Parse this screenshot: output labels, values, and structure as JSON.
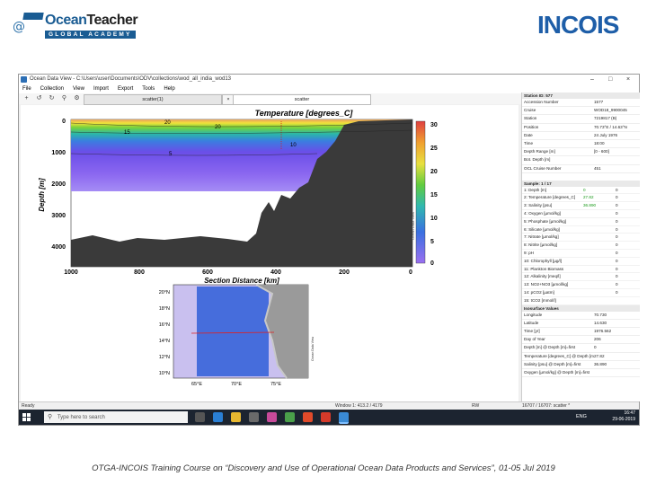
{
  "header": {
    "left_logo_brand": "OceanTeacher",
    "left_logo_ocean": "Ocean",
    "left_logo_teacher": "Teacher",
    "left_logo_sub": "GLOBAL ACADEMY",
    "right_logo": "INCOIS"
  },
  "window": {
    "title": "Ocean Data View - C:\\Users\\user\\Documents\\ODV\\collections\\wod_all_india_wod13",
    "controls": [
      "–",
      "□",
      "×"
    ]
  },
  "menu": [
    "File",
    "Collection",
    "View",
    "Import",
    "Export",
    "Tools",
    "Help"
  ],
  "tabs": [
    "scatter(1)",
    "scatter"
  ],
  "section_plot": {
    "title": "Temperature [degrees_C]",
    "ylabel": "Depth [m]",
    "xlabel": "Section Distance [km]",
    "y_ticks": [
      "0",
      "1000",
      "2000",
      "3000",
      "4000"
    ],
    "x_ticks": [
      "1000",
      "800",
      "600",
      "400",
      "200",
      "0"
    ],
    "contour_labels": [
      "20",
      "15",
      "20",
      "10",
      "5"
    ],
    "colorbar_ticks": [
      "30",
      "25",
      "20",
      "15",
      "10",
      "5",
      "0"
    ],
    "colorbar_caption": "Ocean Data View"
  },
  "map": {
    "lat_ticks": [
      "20°N",
      "18°N",
      "16°N",
      "14°N",
      "12°N",
      "10°N"
    ],
    "lon_ticks": [
      "65°E",
      "70°E",
      "75°E"
    ],
    "caption": "Ocean Data View"
  },
  "station_panel": {
    "header": "Station ID: 577",
    "rows": [
      {
        "k": "Accession Number",
        "v": "1577"
      },
      {
        "k": "Cruise",
        "v": "WOD18_9900045"
      },
      {
        "k": "Station",
        "v": "7219817 (B)"
      },
      {
        "k": "Position",
        "v": "70.73°E / 14.63°N"
      },
      {
        "k": "Date",
        "v": "24 July 1976"
      },
      {
        "k": "Time",
        "v": "18:00"
      },
      {
        "k": "Depth Range [m]",
        "v": "[0 - 600]"
      },
      {
        "k": "Bot. Depth [m]",
        "v": ""
      },
      {
        "k": "OCL Cruise Number",
        "v": "451"
      }
    ]
  },
  "sample_panel": {
    "header": "Sample: 1 / 17",
    "rows": [
      {
        "k": "1: Depth [m]",
        "v1": "0",
        "v2": "0"
      },
      {
        "k": "2: Temperature [degrees_C]",
        "v1": "27.82",
        "v2": "0"
      },
      {
        "k": "3: Salinity [psu]",
        "v1": "36.890",
        "v2": "0"
      },
      {
        "k": "4: Oxygen [µmol/kg]",
        "v1": "",
        "v2": "0"
      },
      {
        "k": "5: Phosphate [µmol/kg]",
        "v1": "",
        "v2": "0"
      },
      {
        "k": "6: Silicate [µmol/kg]",
        "v1": "",
        "v2": "0"
      },
      {
        "k": "7: Nitrate [µmol/kg]",
        "v1": "",
        "v2": "0"
      },
      {
        "k": "8: Nitrite [µmol/kg]",
        "v1": "",
        "v2": "0"
      },
      {
        "k": "9: pH",
        "v1": "",
        "v2": "0"
      },
      {
        "k": "10: Chlorophyll [µg/l]",
        "v1": "",
        "v2": "0"
      },
      {
        "k": "11: Plankton Biomass",
        "v1": "",
        "v2": "0"
      },
      {
        "k": "12: Alkalinity [meq/l]",
        "v1": "",
        "v2": "0"
      },
      {
        "k": "13: NO2+NO3 [µmol/kg]",
        "v1": "",
        "v2": "0"
      },
      {
        "k": "14: pCO2 [µatm]",
        "v1": "",
        "v2": "0"
      },
      {
        "k": "15: tCO2 [mmol/l]",
        "v1": "",
        "v2": ""
      }
    ]
  },
  "isosurface_panel": {
    "header": "Isosurface Values",
    "rows": [
      {
        "k": "Longitude",
        "v": "70.730"
      },
      {
        "k": "Latitude",
        "v": "14.630"
      },
      {
        "k": "Time [yr]",
        "v": "1976.562"
      },
      {
        "k": "Day of Year",
        "v": "206"
      },
      {
        "k": "Depth [m] @ Depth [m]=first",
        "v": "0"
      },
      {
        "k": "Temperature [degrees_C] @ Depth [m]=f...",
        "v": "27.82"
      },
      {
        "k": "Salinity [psu] @ Depth [m]=first",
        "v": "36.890"
      },
      {
        "k": "Oxygen [µmol/kg] @ Depth [m]=first",
        "v": ""
      }
    ]
  },
  "status": {
    "left": "Ready",
    "window": "Window 1: 413.2 / 4179",
    "mode": "RW",
    "record": "16707 / 16707: scatter *"
  },
  "taskbar": {
    "search_placeholder": "Type here to search",
    "lang": "ENG",
    "time": "16:47",
    "date": "29-06-2019"
  },
  "footer": "OTGA-INCOIS Training Course on “Discovery and Use of Operational Ocean Data Products and Services”, 01-05 Jul 2019"
}
